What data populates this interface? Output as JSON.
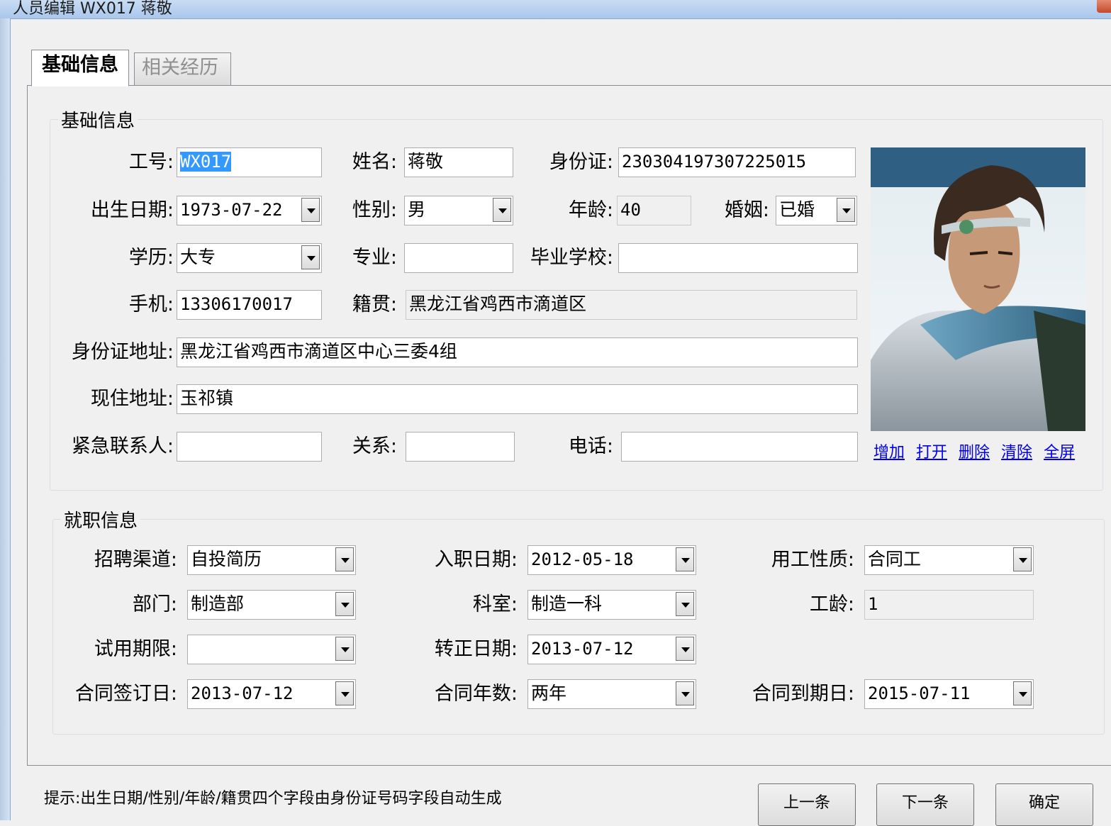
{
  "window": {
    "title": "人员编辑 WX017 蒋敬"
  },
  "tabs": [
    {
      "label": "基础信息",
      "active": true
    },
    {
      "label": "相关经历",
      "active": false
    }
  ],
  "basic": {
    "group_title": "基础信息",
    "emp_id": {
      "label": "工号:",
      "value": "WX017"
    },
    "name": {
      "label": "姓名:",
      "value": "蒋敬"
    },
    "id_card": {
      "label": "身份证:",
      "value": "230304197307225015"
    },
    "birth_date": {
      "label": "出生日期:",
      "value": "1973-07-22"
    },
    "gender": {
      "label": "性别:",
      "value": "男"
    },
    "age": {
      "label": "年龄:",
      "value": "40"
    },
    "marriage": {
      "label": "婚姻:",
      "value": "已婚"
    },
    "education": {
      "label": "学历:",
      "value": "大专"
    },
    "major": {
      "label": "专业:",
      "value": ""
    },
    "school": {
      "label": "毕业学校:",
      "value": ""
    },
    "mobile": {
      "label": "手机:",
      "value": "13306170017"
    },
    "native_place": {
      "label": "籍贯:",
      "value": "黑龙江省鸡西市滴道区"
    },
    "id_address": {
      "label": "身份证地址:",
      "value": "黑龙江省鸡西市滴道区中心三委4组"
    },
    "current_address": {
      "label": "现住地址:",
      "value": "玉祁镇"
    },
    "emergency_contact": {
      "label": "紧急联系人:",
      "value": ""
    },
    "relation": {
      "label": "关系:",
      "value": ""
    },
    "phone": {
      "label": "电话:",
      "value": ""
    },
    "photo_links": [
      "增加",
      "打开",
      "删除",
      "清除",
      "全屏"
    ]
  },
  "job": {
    "group_title": "就职信息",
    "channel": {
      "label": "招聘渠道:",
      "value": "自投简历"
    },
    "hire_date": {
      "label": "入职日期:",
      "value": "2012-05-18"
    },
    "employment_type": {
      "label": "用工性质:",
      "value": "合同工"
    },
    "department": {
      "label": "部门:",
      "value": "制造部"
    },
    "section": {
      "label": "科室:",
      "value": "制造一科"
    },
    "seniority": {
      "label": "工龄:",
      "value": "1"
    },
    "probation": {
      "label": "试用期限:",
      "value": ""
    },
    "regular_date": {
      "label": "转正日期:",
      "value": "2013-07-12"
    },
    "contract_sign": {
      "label": "合同签订日:",
      "value": "2013-07-12"
    },
    "contract_years": {
      "label": "合同年数:",
      "value": "两年"
    },
    "contract_end": {
      "label": "合同到期日:",
      "value": "2015-07-11"
    }
  },
  "footer": {
    "hint": "提示:出生日期/性别/年龄/籍贯四个字段由身份证号码字段自动生成",
    "prev": "上一条",
    "next": "下一条",
    "ok": "确定"
  }
}
